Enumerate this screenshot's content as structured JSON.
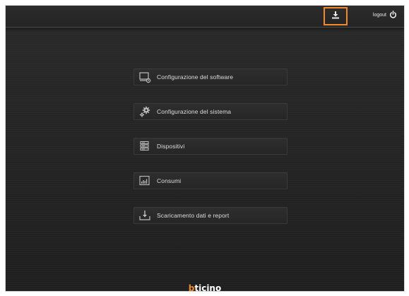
{
  "header": {
    "download_icon": "download-icon",
    "logout_label": "logout",
    "logout_icon": "power-icon",
    "highlight_color": "#f08a2a"
  },
  "menu": {
    "items": [
      {
        "label": "Configurazione del software",
        "icon": "monitor-gear-icon"
      },
      {
        "label": "Configurazione del sistema",
        "icon": "gears-icon"
      },
      {
        "label": "Dispositivi",
        "icon": "devices-stack-icon"
      },
      {
        "label": "Consumi",
        "icon": "bar-chart-icon"
      },
      {
        "label": "Scaricamento dati e report",
        "icon": "tray-download-icon"
      }
    ]
  },
  "footer": {
    "brand_b": "b",
    "brand_rest": "ticino"
  }
}
